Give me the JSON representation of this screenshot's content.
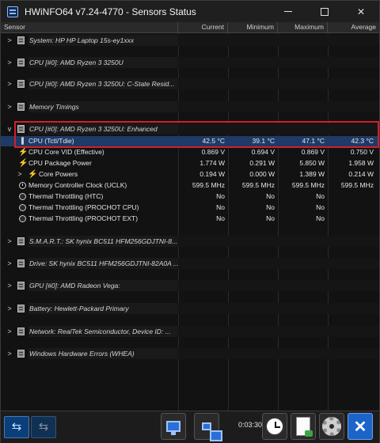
{
  "window": {
    "title": "HWiNFO64 v7.24-4770 - Sensors Status",
    "controls": {
      "minimize": "—",
      "maximize": "",
      "close": "✕"
    }
  },
  "columns": {
    "sensor": "Sensor",
    "current": "Current",
    "minimum": "Minimum",
    "maximum": "Maximum",
    "average": "Average"
  },
  "groups": [
    {
      "label": "System: HP HP Laptop 15s-ey1xxx",
      "expanded": false
    },
    {
      "label": "CPU [#0]: AMD Ryzen 3 3250U",
      "expanded": false
    },
    {
      "label": "CPU [#0]: AMD Ryzen 3 3250U: C-State Resid...",
      "expanded": false
    },
    {
      "label": "Memory Timings",
      "expanded": false
    },
    {
      "label": "CPU [#0]: AMD Ryzen 3 3250U: Enhanced",
      "expanded": true
    },
    {
      "label": "S.M.A.R.T.: SK hynix BC511 HFM256GDJTNI-8...",
      "expanded": false
    },
    {
      "label": "Drive: SK hynix BC511 HFM256GDJTNI-82A0A ...",
      "expanded": false
    },
    {
      "label": "GPU [#0]: AMD Radeon Vega:",
      "expanded": false
    },
    {
      "label": "Battery: Hewlett-Packard Primary",
      "expanded": false
    },
    {
      "label": "Network: RealTek Semiconductor, Device ID: ...",
      "expanded": false
    },
    {
      "label": "Windows Hardware Errors (WHEA)",
      "expanded": false
    }
  ],
  "sensors": [
    {
      "label": "CPU (Tctl/Tdie)",
      "icon": "thermometer-icon",
      "current": "42.5 °C",
      "minimum": "39.1 °C",
      "maximum": "47.1 °C",
      "average": "42.3 °C",
      "selected": true
    },
    {
      "label": "CPU Core VID (Effective)",
      "icon": "bolt-icon",
      "current": "0.869 V",
      "minimum": "0.694 V",
      "maximum": "0.869 V",
      "average": "0.750 V"
    },
    {
      "label": "CPU Package Power",
      "icon": "bolt-icon",
      "current": "1.774 W",
      "minimum": "0.291 W",
      "maximum": "5.850 W",
      "average": "1.958 W"
    },
    {
      "label": "Core Powers",
      "icon": "bolt-icon",
      "current": "0.194 W",
      "minimum": "0.000 W",
      "maximum": "1.389 W",
      "average": "0.214 W",
      "expandable": true
    },
    {
      "label": "Memory Controller Clock (UCLK)",
      "icon": "clock-icon",
      "current": "599.5 MHz",
      "minimum": "599.5 MHz",
      "maximum": "599.5 MHz",
      "average": "599.5 MHz"
    },
    {
      "label": "Thermal Throttling (HTC)",
      "icon": "circle-icon",
      "current": "No",
      "minimum": "No",
      "maximum": "No",
      "average": ""
    },
    {
      "label": "Thermal Throttling (PROCHOT CPU)",
      "icon": "circle-icon",
      "current": "No",
      "minimum": "No",
      "maximum": "No",
      "average": ""
    },
    {
      "label": "Thermal Throttling (PROCHOT EXT)",
      "icon": "circle-icon",
      "current": "No",
      "minimum": "No",
      "maximum": "No",
      "average": ""
    }
  ],
  "toolbar": {
    "timer": "0:03:30",
    "icons": [
      "arrow-left-right-icon",
      "arrow-left-right-icon",
      "monitor-icon",
      "network-icon",
      "clock-icon",
      "report-icon",
      "gear-icon",
      "close-icon"
    ]
  },
  "colors": {
    "highlight_box": "#d01f2f",
    "selected_row": "#1f3a66",
    "bolt": "#f0b400",
    "close_button": "#1c64c8"
  }
}
